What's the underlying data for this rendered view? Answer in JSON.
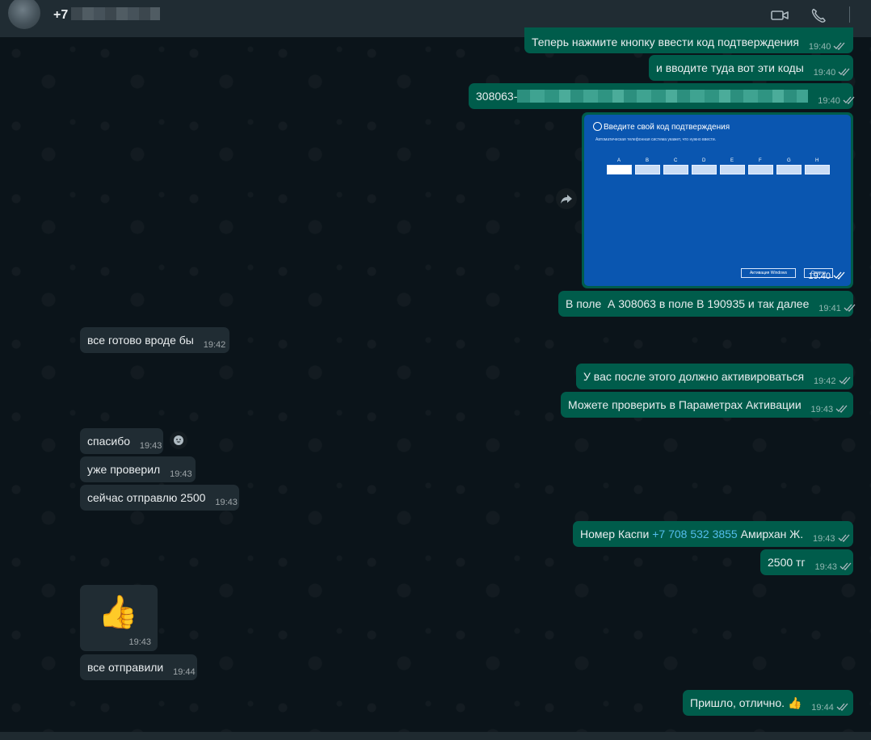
{
  "header": {
    "contact_name": "+7 7",
    "icons": [
      "video-call-icon",
      "voice-call-icon"
    ]
  },
  "messages": [
    {
      "id": "m1",
      "direction": "out",
      "text": "Теперь нажмите кнопку ввести код подтверждения",
      "time": "19:40",
      "status": "read"
    },
    {
      "id": "m2",
      "direction": "out",
      "text": "и вводите туда вот эти коды",
      "time": "19:40",
      "status": "read"
    },
    {
      "id": "m3",
      "direction": "out",
      "text": "308063-",
      "time": "19:40",
      "status": "read"
    },
    {
      "id": "m4",
      "direction": "out",
      "type": "image",
      "time": "19:40",
      "status": "read",
      "image": {
        "title": "Введите свой код подтверждения",
        "subtitle": "Автоматическая телефонная система укажет, что нужно ввести.",
        "fields": [
          "A",
          "B",
          "C",
          "D",
          "E",
          "F",
          "G",
          "H"
        ],
        "buttons": [
          "Активация Windows",
          "Отмена"
        ]
      }
    },
    {
      "id": "m5",
      "direction": "out",
      "text": "В поле  А 308063 в поле В 190935 и так далее",
      "time": "19:41",
      "status": "read"
    },
    {
      "id": "m6",
      "direction": "in",
      "text": "все готово вроде бы",
      "time": "19:42"
    },
    {
      "id": "m7",
      "direction": "out",
      "text": "У вас после этого должно активироваться",
      "time": "19:42",
      "status": "read"
    },
    {
      "id": "m8",
      "direction": "out",
      "text": "Можете проверить в Параметрах Активации",
      "time": "19:43",
      "status": "read"
    },
    {
      "id": "m9",
      "direction": "in",
      "text": "спасибо",
      "time": "19:43"
    },
    {
      "id": "m10",
      "direction": "in",
      "text": "уже проверил",
      "time": "19:43"
    },
    {
      "id": "m11",
      "direction": "in",
      "text": "сейчас отправлю 2500",
      "time": "19:43"
    },
    {
      "id": "m12",
      "direction": "out",
      "text_before": "Номер Каспи ",
      "link": "+7 708 532 3855",
      "text_after": " Амирхан Ж.",
      "time": "19:43",
      "status": "read"
    },
    {
      "id": "m13",
      "direction": "out",
      "text": "2500 тг",
      "time": "19:43",
      "status": "read"
    },
    {
      "id": "m14",
      "direction": "in",
      "type": "sticker",
      "sticker": "👍",
      "time": "19:43"
    },
    {
      "id": "m15",
      "direction": "in",
      "text": "все отправили",
      "time": "19:44"
    },
    {
      "id": "m16",
      "direction": "out",
      "text": "Пришло, отлично. 👍",
      "time": "19:44",
      "status": "read"
    }
  ],
  "colors": {
    "background": "#0b141a",
    "header": "#202c33",
    "outgoing_bubble": "#005c4b",
    "incoming_bubble": "#202c33",
    "link": "#53bdeb"
  }
}
